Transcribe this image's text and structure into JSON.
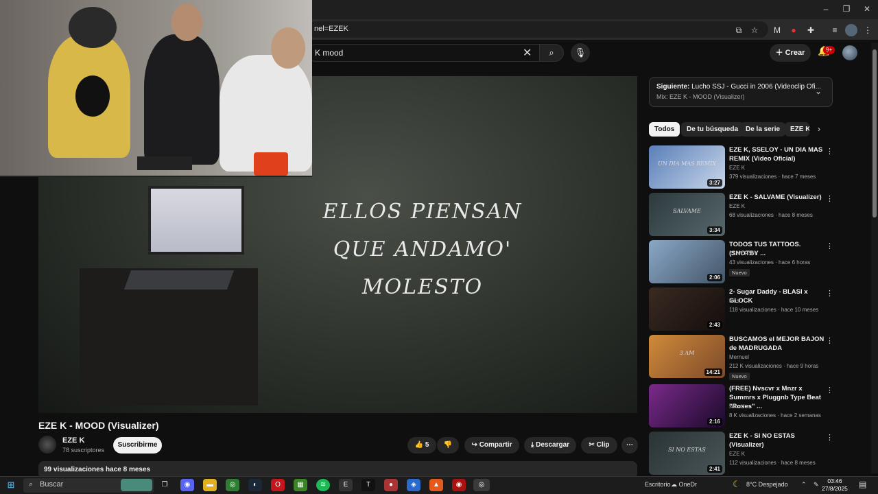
{
  "browser": {
    "url_text": "nel=EZEK",
    "window_controls": [
      "–",
      "❐",
      "✕"
    ]
  },
  "youtube_header": {
    "search_value": "K mood",
    "create_label": "Crear",
    "notifications_badge": "9+"
  },
  "video": {
    "lyrics_lines": [
      "ELLOS PIENSAN",
      "QUE ANDAMO'",
      "MOLESTO"
    ],
    "title": "EZE K - MOOD (Visualizer)",
    "channel_name": "EZE K",
    "subscribers": "78 suscriptores",
    "subscribe_label": "Suscribirme",
    "likes": "5",
    "share_label": "Compartir",
    "download_label": "Descargar",
    "clip_label": "Clip",
    "description_summary": "99 visualizaciones  hace 8 meses"
  },
  "sidebar": {
    "next_label": "Siguiente:",
    "next_title": "Lucho SSJ - Gucci in 2006 (Videoclip Ofi...",
    "mix_label": "Mix: EZE K - MOOD (Visualizer)",
    "chips": [
      "Todos",
      "De tu búsqueda",
      "De la serie",
      "EZE K"
    ],
    "videos": [
      {
        "title": "EZE K, SSELOY - UN DIA MAS REMIX (Video Oficial)",
        "channel": "EZE K",
        "stats": "379 visualizaciones  ·  hace 7 meses",
        "duration": "3:27",
        "badge": "",
        "thumb_text": "UN DIA MAS REMIX",
        "colors": [
          "#5a7fb8",
          "#c9d6ea"
        ]
      },
      {
        "title": "EZE K - SALVAME (Visualizer)",
        "channel": "EZE K",
        "stats": "68 visualizaciones  ·  hace 8 meses",
        "duration": "3:34",
        "badge": "",
        "thumb_text": "SALVAME",
        "colors": [
          "#2c3a3e",
          "#58676b"
        ]
      },
      {
        "title": "TODOS TUS TATTOOS. (SHOTBY ...",
        "channel": "EL VERSHI",
        "stats": "43 visualizaciones  ·  hace 6 horas",
        "duration": "2:06",
        "badge": "Nuevo",
        "thumb_text": "",
        "colors": [
          "#8aa8c8",
          "#445566"
        ]
      },
      {
        "title": "2- Sugar Daddy - BLASI x GLOCK",
        "channel": "blasi",
        "stats": "118 visualizaciones  ·  hace 10 meses",
        "duration": "2:43",
        "badge": "",
        "thumb_text": "",
        "colors": [
          "#3a2a22",
          "#140e0c"
        ]
      },
      {
        "title": "BUSCAMOS el MEJOR BAJON de MADRUGADA",
        "channel": "Mernuel",
        "stats": "212 K visualizaciones  ·  hace 9 horas",
        "duration": "14:21",
        "badge": "Nuevo",
        "thumb_text": "3 AM",
        "colors": [
          "#d08a3a",
          "#7c4a2a"
        ]
      },
      {
        "title": "(FREE) Nvscvr x Mnzr x Summrs x Pluggnb Type Beat \"Roses\" ...",
        "channel": "satori*",
        "stats": "8 K visualizaciones  ·  hace 2 semanas",
        "duration": "2:16",
        "badge": "",
        "thumb_text": "",
        "colors": [
          "#7a2a8a",
          "#1a0a2a"
        ]
      },
      {
        "title": "EZE K - SI NO ESTAS (Visualizer)",
        "channel": "EZE K",
        "stats": "112 visualizaciones  ·  hace 8 meses",
        "duration": "2:41",
        "badge": "",
        "thumb_text": "SI NO ESTAS",
        "colors": [
          "#2a3436",
          "#4a5558"
        ]
      }
    ]
  },
  "taskbar": {
    "search_placeholder": "Buscar",
    "desktop_label": "Escritorio",
    "onedrive_label": "OneDr",
    "weather": "8°C  Despejado",
    "time": "03:46",
    "date": "27/8/2025"
  }
}
